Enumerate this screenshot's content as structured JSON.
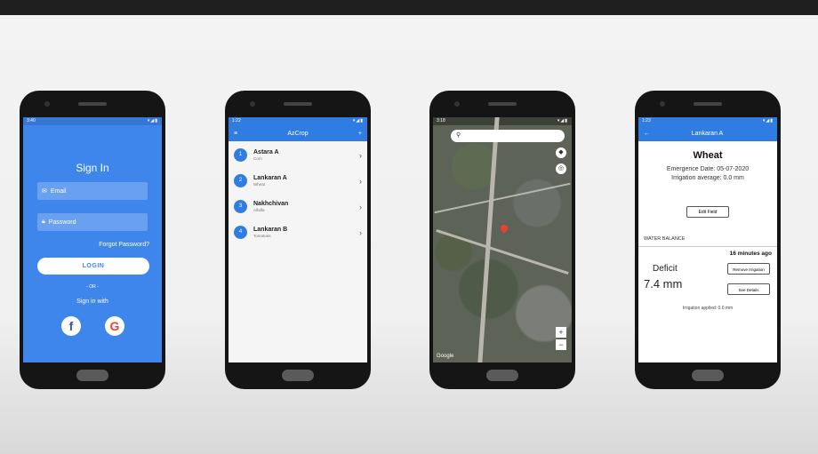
{
  "phone1": {
    "status_time": "3:40",
    "title": "Sign In",
    "email_placeholder": "Email",
    "password_placeholder": "Password",
    "forgot": "Forgot Password?",
    "login": "LOGIN",
    "or": "- OR -",
    "sign_with": "Sign in with",
    "facebook_glyph": "f",
    "google_glyph": "G"
  },
  "phone2": {
    "status_time": "1:22",
    "title": "AzCrop",
    "items": [
      {
        "num": "1",
        "name": "Astara A",
        "crop": "Corn"
      },
      {
        "num": "2",
        "name": "Lankaran A",
        "crop": "Wheat"
      },
      {
        "num": "3",
        "name": "Nakhchivan",
        "crop": "Alfalfa"
      },
      {
        "num": "4",
        "name": "Lankaran B",
        "crop": "Tomatoes"
      }
    ]
  },
  "phone3": {
    "status_time": "3:18",
    "google": "Google",
    "zoom_in": "+",
    "zoom_out": "−"
  },
  "phone4": {
    "status_time": "1:23",
    "title": "Lankaran A",
    "crop": "Wheat",
    "emergence": "Emergence Date: 05-07-2020",
    "irrigation_avg": "Irrigation average: 0.0 mm",
    "edit": "Edit Field",
    "water_balance": "WATER BALANCE",
    "ago": "16 minutes ago",
    "deficit_label": "Deficit",
    "deficit_value": "7.4 mm",
    "remove": "Remove Irrigation",
    "details": "See Details",
    "applied": "Irrigation applied: 0.0 mm"
  },
  "colors": {
    "primary": "#2f7de3",
    "signin_bg": "#3f86ec",
    "pin": "#e94235"
  }
}
